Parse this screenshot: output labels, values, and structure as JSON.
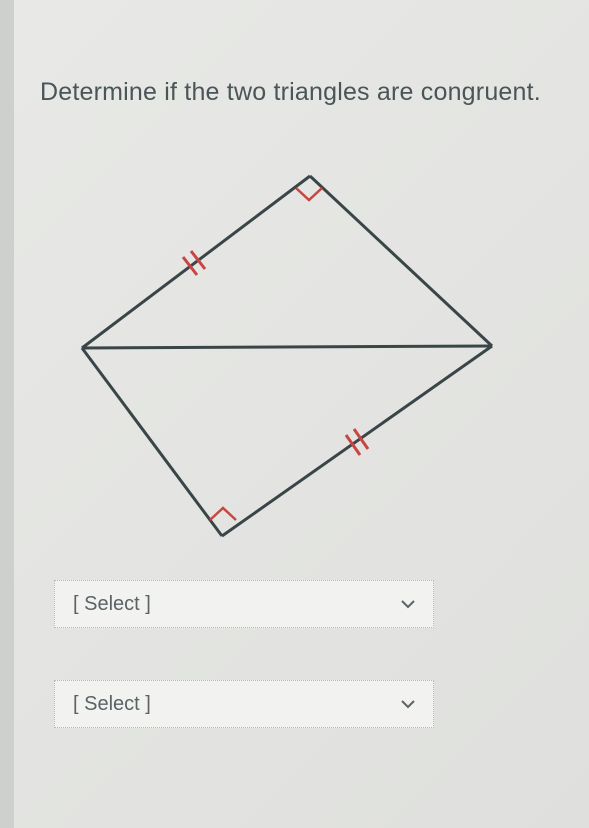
{
  "question": {
    "prompt": "Determine if the two triangles are congruent."
  },
  "dropdowns": {
    "first": {
      "placeholder": "[ Select ]"
    },
    "second": {
      "placeholder": "[ Select ]"
    }
  },
  "diagram": {
    "type": "geometry",
    "description": "Two triangles sharing a common hypotenuse forming a quadrilateral, each with a right angle marked and one pair of congruent sides marked with double tick marks"
  }
}
